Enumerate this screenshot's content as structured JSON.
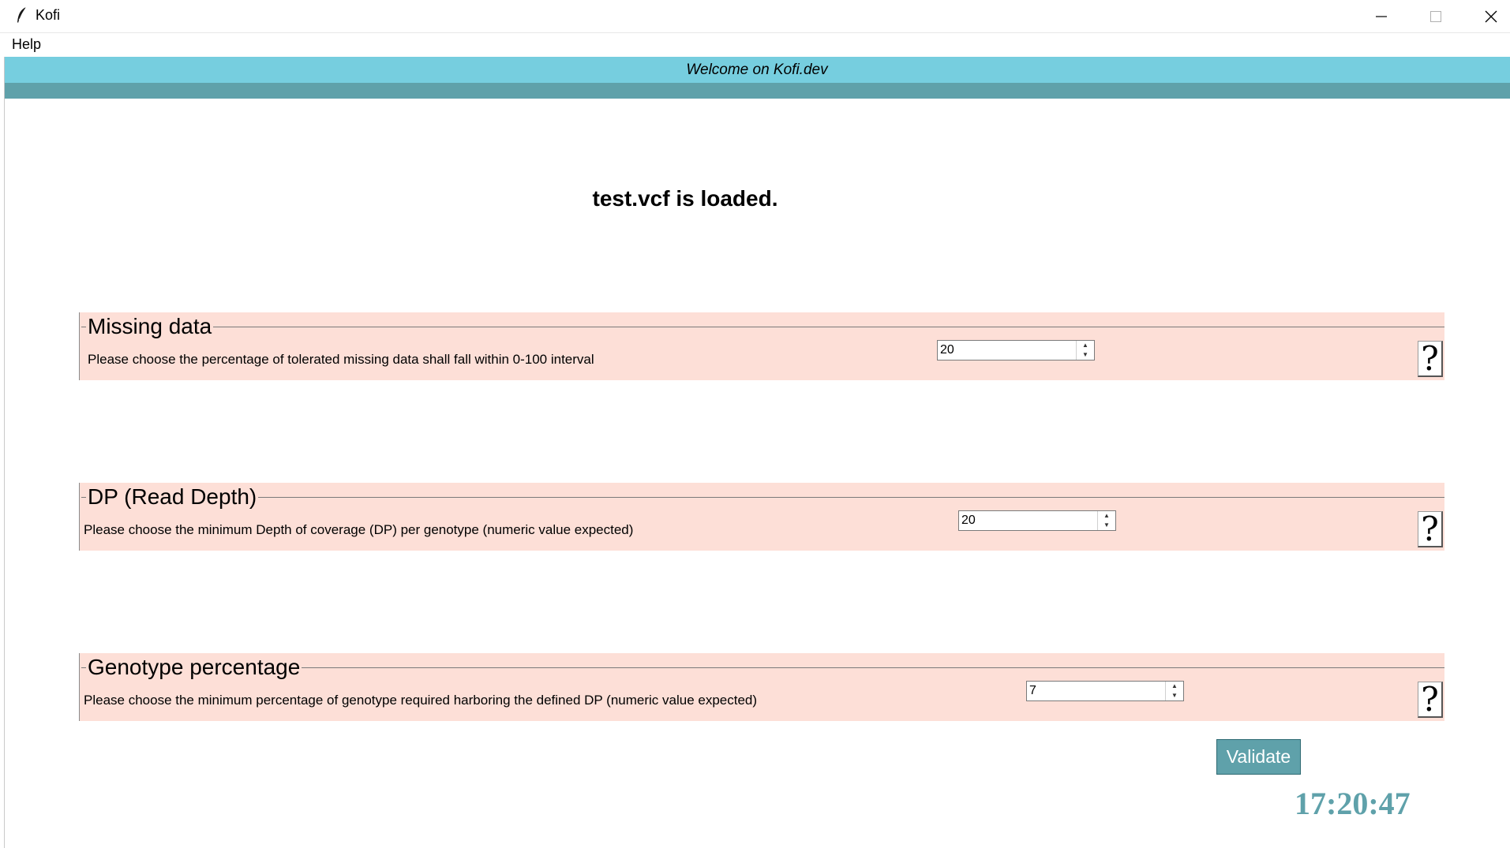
{
  "window": {
    "title": "Kofi",
    "minimize_glyph": "—",
    "maximize_glyph": "☐",
    "close_glyph": "✕",
    "icon": "feather-icon"
  },
  "menu": {
    "help_label": "Help"
  },
  "banner": {
    "welcome_text": "Welcome on Kofi.dev",
    "color": "#76cedf",
    "strip_color": "#5fa1aa"
  },
  "status": {
    "loaded_text": "test.vcf is loaded."
  },
  "panels": [
    {
      "legend": "Missing data",
      "description": "Please choose the percentage of tolerated missing data shall fall within 0-100 interval",
      "value": "20",
      "help_glyph": "?"
    },
    {
      "legend": "DP (Read Depth)",
      "description": "Please choose the minimum Depth of coverage (DP) per genotype (numeric value expected)",
      "value": "20",
      "help_glyph": "?"
    },
    {
      "legend": "Genotype percentage",
      "description": "Please choose the minimum percentage of genotype required harboring the defined DP (numeric value expected)",
      "value": "7",
      "help_glyph": "?"
    }
  ],
  "panel_color": "#fddfd7",
  "spinner": {
    "up_glyph": "▲",
    "down_glyph": "▼"
  },
  "validate_label": "Validate",
  "clock": "17:20:47"
}
